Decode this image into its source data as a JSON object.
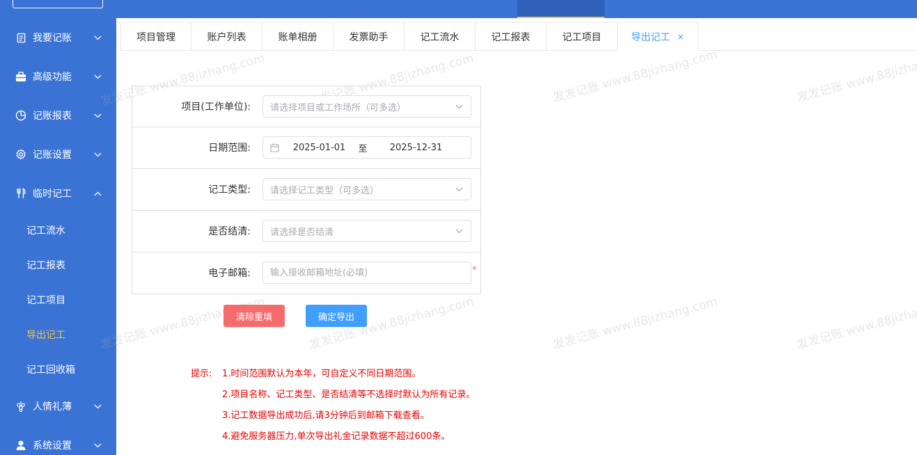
{
  "topbar": {
    "logo_text": "",
    "nav_items": [
      "",
      "",
      "",
      "",
      "",
      ""
    ]
  },
  "sidebar": {
    "items": [
      {
        "label": "我要记账",
        "icon": "document-icon",
        "expanded": false
      },
      {
        "label": "高级功能",
        "icon": "briefcase-icon",
        "expanded": false
      },
      {
        "label": "记账报表",
        "icon": "pie-chart-icon",
        "expanded": false
      },
      {
        "label": "记账设置",
        "icon": "gear-icon",
        "expanded": false
      },
      {
        "label": "临时记工",
        "icon": "fork-knife-icon",
        "expanded": true
      },
      {
        "label": "人情礼薄",
        "icon": "grapes-icon",
        "expanded": false
      },
      {
        "label": "系统设置",
        "icon": "user-icon",
        "expanded": false
      }
    ],
    "sub_items": [
      {
        "label": "记工流水",
        "active": false
      },
      {
        "label": "记工报表",
        "active": false
      },
      {
        "label": "记工项目",
        "active": false
      },
      {
        "label": "导出记工",
        "active": true
      },
      {
        "label": "记工回收箱",
        "active": false
      }
    ]
  },
  "tabs": [
    {
      "label": "项目管理"
    },
    {
      "label": "账户列表"
    },
    {
      "label": "账单相册"
    },
    {
      "label": "发票助手"
    },
    {
      "label": "记工流水"
    },
    {
      "label": "记工报表"
    },
    {
      "label": "记工项目"
    },
    {
      "label": "导出记工",
      "active": true,
      "close": "×"
    }
  ],
  "form": {
    "project": {
      "label": "项目(工作单位):",
      "placeholder": "请选择项目或工作场所（可多选）"
    },
    "date_range": {
      "label": "日期范围:",
      "start": "2025-01-01",
      "separator": "至",
      "end": "2025-12-31"
    },
    "work_type": {
      "label": "记工类型:",
      "placeholder": "请选择记工类型（可多选）"
    },
    "settled": {
      "label": "是否结清:",
      "placeholder": "请选择是否结清"
    },
    "email": {
      "label": "电子邮箱:",
      "placeholder": "输入接收邮箱地址(必填)",
      "required_mark": "*"
    }
  },
  "buttons": {
    "reset": "清除重填",
    "export": "确定导出"
  },
  "tips": {
    "label": "提示:",
    "lines": [
      "1.时间范围默认为本年，可自定义不同日期范围。",
      "2.项目名称、记工类型、是否结清等不选择时默认为所有记录。",
      "3.记工数据导出成功后,请3分钟后到邮箱下载查看。",
      "4.避免服务器压力,单次导出礼金记录数据不超过600条。"
    ]
  },
  "watermark": "发发记账 www.88jizhang.com",
  "colors": {
    "sidebar_bg": "#3a73d4",
    "active_sub": "#f5c341",
    "primary": "#409eff",
    "danger": "#f56c6c",
    "tip_text": "#e60000"
  }
}
